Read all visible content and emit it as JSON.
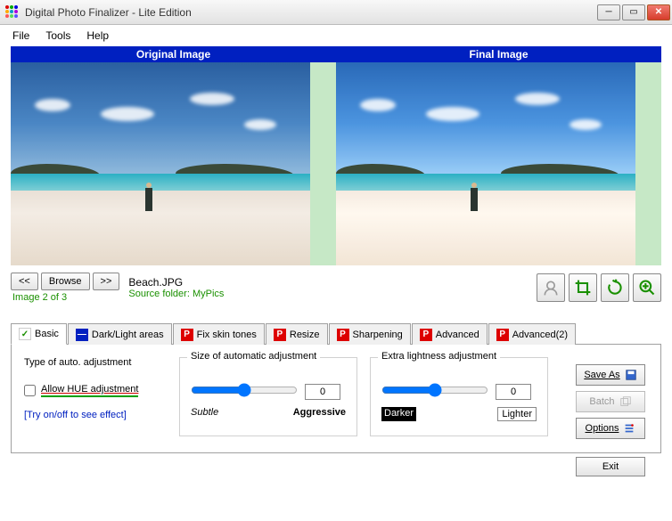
{
  "window": {
    "title": "Digital Photo Finalizer - Lite Edition"
  },
  "menu": {
    "file": "File",
    "tools": "Tools",
    "help": "Help"
  },
  "headers": {
    "original": "Original Image",
    "final": "Final Image"
  },
  "nav": {
    "prev": "<<",
    "browse": "Browse",
    "next": ">>"
  },
  "file": {
    "name": "Beach.JPG",
    "source_prefix": "Source folder: ",
    "source_folder": "MyPics",
    "page": "Image 2 of 3"
  },
  "tabs": [
    {
      "label": "Basic",
      "icon": "check",
      "active": true
    },
    {
      "label": "Dark/Light areas",
      "icon": "minus",
      "active": false
    },
    {
      "label": "Fix skin tones",
      "icon": "p",
      "active": false
    },
    {
      "label": "Resize",
      "icon": "p",
      "active": false
    },
    {
      "label": "Sharpening",
      "icon": "p",
      "active": false
    },
    {
      "label": "Advanced",
      "icon": "p",
      "active": false
    },
    {
      "label": "Advanced(2)",
      "icon": "p",
      "active": false
    }
  ],
  "panel": {
    "type_title": "Type of auto. adjustment",
    "hue_label": "Allow HUE adjustment",
    "hue_checked": false,
    "try_hint": "[Try on/off to see effect]",
    "size_title": "Size of automatic adjustment",
    "size_value": "0",
    "size_left": "Subtle",
    "size_right": "Aggressive",
    "extra_title": "Extra lightness adjustment",
    "extra_value": "0",
    "extra_left": "Darker",
    "extra_right": "Lighter"
  },
  "buttons": {
    "save_as": "Save As",
    "batch": "Batch",
    "options": "Options",
    "exit": "Exit"
  },
  "icon_dots": [
    "#d00",
    "#0a0",
    "#00d",
    "#fa0",
    "#09c",
    "#a0d",
    "#f55",
    "#5d5",
    "#55f"
  ]
}
